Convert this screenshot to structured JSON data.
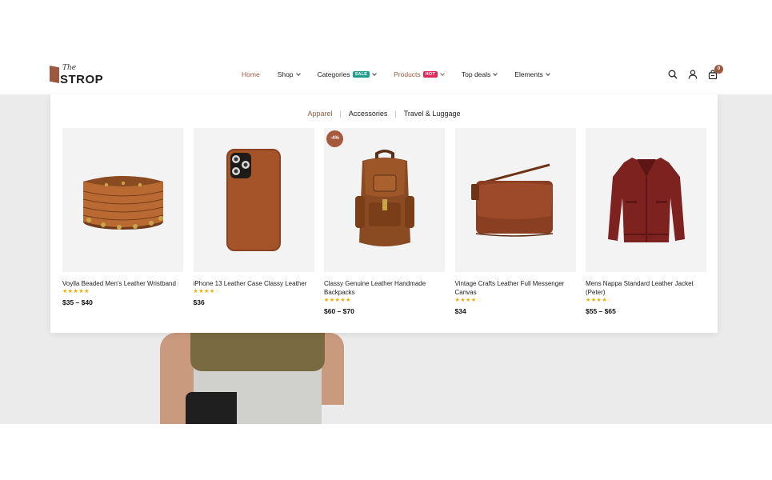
{
  "brand": {
    "the": "The",
    "name": "STROP"
  },
  "nav": [
    {
      "label": "Home",
      "active": true,
      "chevron": false,
      "badge": ""
    },
    {
      "label": "Shop",
      "active": false,
      "chevron": true,
      "badge": ""
    },
    {
      "label": "Categories",
      "active": false,
      "chevron": true,
      "badge": "SALE"
    },
    {
      "label": "Products",
      "active": false,
      "chevron": true,
      "badge": "HOT"
    },
    {
      "label": "Top deals",
      "active": false,
      "chevron": true,
      "badge": ""
    },
    {
      "label": "Elements",
      "active": false,
      "chevron": true,
      "badge": ""
    }
  ],
  "header_icons": {
    "search": "search-icon",
    "account": "user-icon",
    "cart": "shopping-bag-icon",
    "cart_count": "0"
  },
  "mega_menu": {
    "tabs": [
      {
        "label": "Apparel",
        "active": true
      },
      {
        "label": "Accessories",
        "active": false
      },
      {
        "label": "Travel & Luggage",
        "active": false
      }
    ],
    "products": [
      {
        "name": "Voylla Beaded Men's Leather Wristband",
        "rating": 5,
        "price": "$35 – $40",
        "discount": "",
        "image": "leather-wristband"
      },
      {
        "name": "iPhone 13 Leather Case Classy Leather",
        "rating": 4,
        "price": "$36",
        "discount": "",
        "image": "phone-case"
      },
      {
        "name": "Classy Genuine Leather Handmade Backpacks",
        "rating": 5,
        "price": "$60 – $70",
        "discount": "-4%",
        "image": "leather-backpack"
      },
      {
        "name": "Vintage Crafts Leather Full Messenger Canvas",
        "rating": 4,
        "price": "$34",
        "discount": "",
        "image": "messenger-bag"
      },
      {
        "name": "Mens Nappa Standard Leather Jacket (Peter)",
        "rating": 4,
        "price": "$55 – $65",
        "discount": "",
        "image": "leather-jacket"
      }
    ]
  },
  "colors": {
    "accent": "#9b5a3f",
    "sale_badge": "#1e9e8a",
    "hot_badge": "#e4275b",
    "star": "#f2a900",
    "hero_bg": "#ebebeb"
  }
}
